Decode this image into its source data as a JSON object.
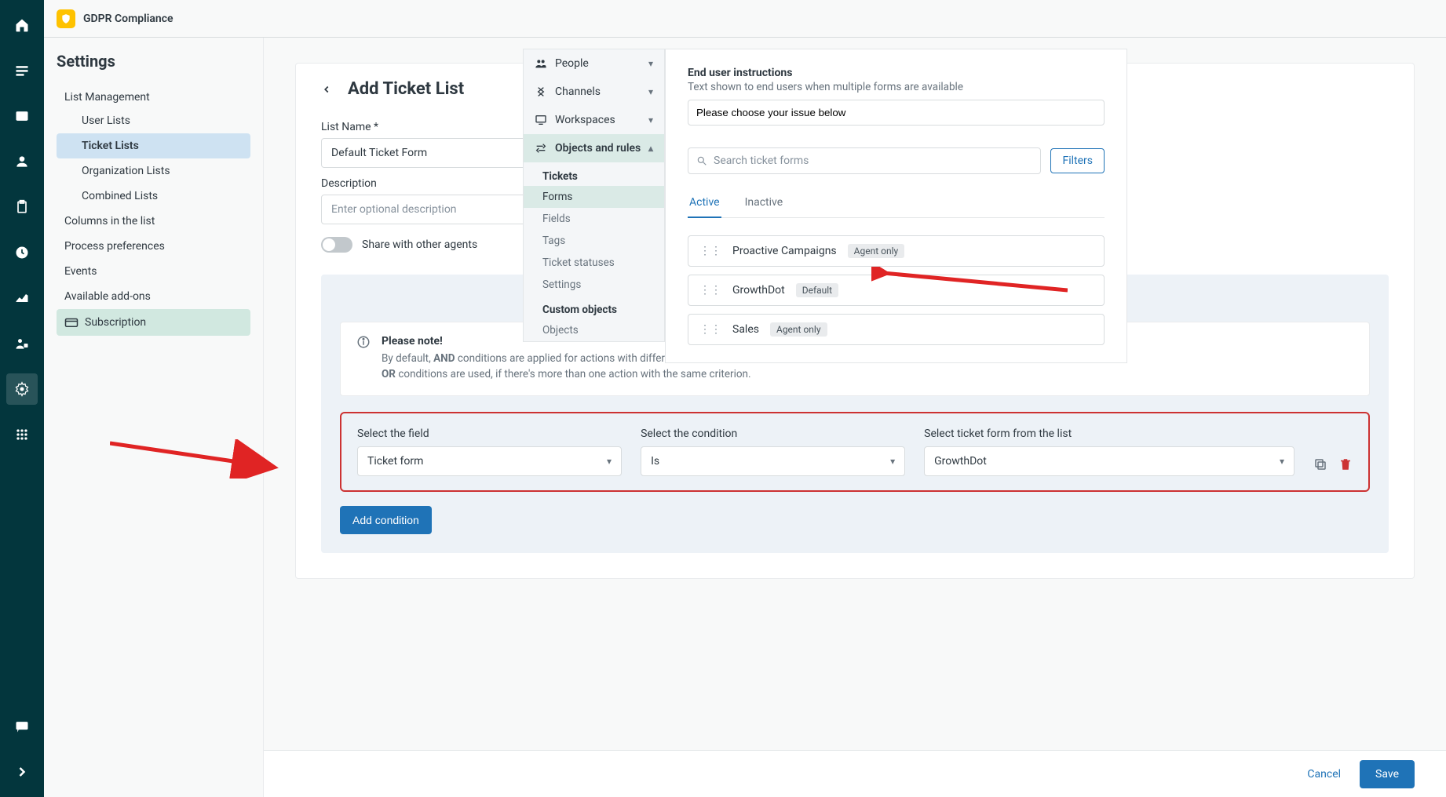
{
  "app": {
    "title": "GDPR Compliance"
  },
  "rail": {
    "items": [
      "home",
      "list",
      "inbox",
      "user-badge",
      "clipboard",
      "clock",
      "chart",
      "user-lock",
      "gear",
      "grid"
    ],
    "bottom": [
      "comment",
      "chevron"
    ]
  },
  "settings": {
    "title": "Settings",
    "nav": {
      "list_management": "List Management",
      "user_lists": "User Lists",
      "ticket_lists": "Ticket Lists",
      "organization_lists": "Organization Lists",
      "combined_lists": "Combined Lists",
      "columns": "Columns in the list",
      "process_prefs": "Process preferences",
      "events": "Events",
      "addons": "Available add-ons",
      "subscription": "Subscription"
    }
  },
  "page": {
    "title": "Add Ticket List",
    "list_name_label": "List Name *",
    "list_name_value": "Default Ticket Form",
    "description_label": "Description",
    "description_placeholder": "Enter optional description",
    "share_label": "Share with other agents"
  },
  "note": {
    "title": "Please note!",
    "line1_pre": "By default, ",
    "line1_bold": "AND",
    "line1_post": " conditions are applied for actions with different criteria.",
    "line2_bold": "OR",
    "line2_post": " conditions are used, if there's more than one action with the same criterion."
  },
  "condition": {
    "field_label": "Select the field",
    "field_value": "Ticket form",
    "cond_label": "Select the condition",
    "cond_value": "Is",
    "value_label": "Select ticket form from the list",
    "value_value": "GrowthDot",
    "add_button": "Add condition"
  },
  "float_nav": {
    "people": "People",
    "channels": "Channels",
    "workspaces": "Workspaces",
    "objects_rules": "Objects and rules",
    "tickets_hd": "Tickets",
    "forms": "Forms",
    "fields": "Fields",
    "tags": "Tags",
    "ticket_statuses": "Ticket statuses",
    "settings": "Settings",
    "custom_objects_hd": "Custom objects",
    "objects": "Objects"
  },
  "forms_panel": {
    "instructions_title": "End user instructions",
    "instructions_sub": "Text shown to end users when multiple forms are available",
    "instructions_value": "Please choose your issue below",
    "search_placeholder": "Search ticket forms",
    "filters": "Filters",
    "tab_active": "Active",
    "tab_inactive": "Inactive",
    "items": [
      {
        "name": "Proactive Campaigns",
        "badge": "Agent only"
      },
      {
        "name": "GrowthDot",
        "badge": "Default"
      },
      {
        "name": "Sales",
        "badge": "Agent only"
      }
    ]
  },
  "footer": {
    "cancel": "Cancel",
    "save": "Save"
  }
}
